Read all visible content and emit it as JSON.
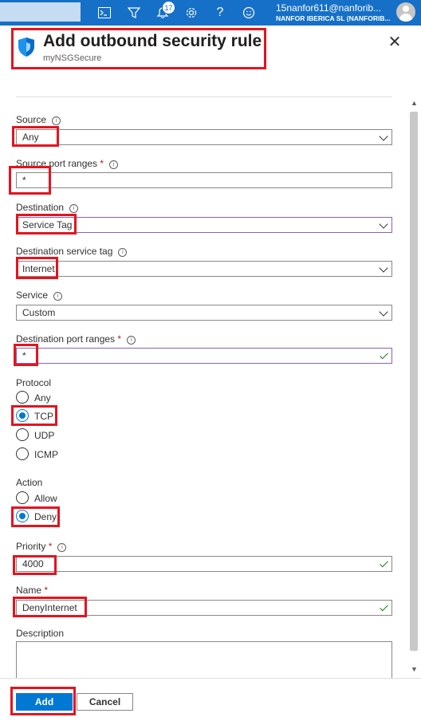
{
  "topbar": {
    "notifications_count": "17",
    "account_name": "15nanfor611@nanforib...",
    "account_org": "NANFOR IBERICA SL (NANFORIB..."
  },
  "panel": {
    "title": "Add outbound security rule",
    "subtitle": "myNSGSecure"
  },
  "form": {
    "source_label": "Source",
    "source_value": "Any",
    "source_port_label": "Source port ranges",
    "source_port_value": "*",
    "destination_label": "Destination",
    "destination_value": "Service Tag",
    "dest_service_tag_label": "Destination service tag",
    "dest_service_tag_value": "Internet",
    "service_label": "Service",
    "service_value": "Custom",
    "dest_port_label": "Destination port ranges",
    "dest_port_value": "*",
    "protocol_label": "Protocol",
    "protocol_options": [
      "Any",
      "TCP",
      "UDP",
      "ICMP"
    ],
    "protocol_selected": "TCP",
    "action_label": "Action",
    "action_options": [
      "Allow",
      "Deny"
    ],
    "action_selected": "Deny",
    "priority_label": "Priority",
    "priority_value": "4000",
    "name_label": "Name",
    "name_value": "DenyInternet",
    "description_label": "Description",
    "required_marker": "*"
  },
  "footer": {
    "add_label": "Add",
    "cancel_label": "Cancel"
  },
  "colors": {
    "topbar": "#1670c8",
    "primary": "#0078d4",
    "highlight": "#e3141f",
    "valid": "#107c10"
  }
}
